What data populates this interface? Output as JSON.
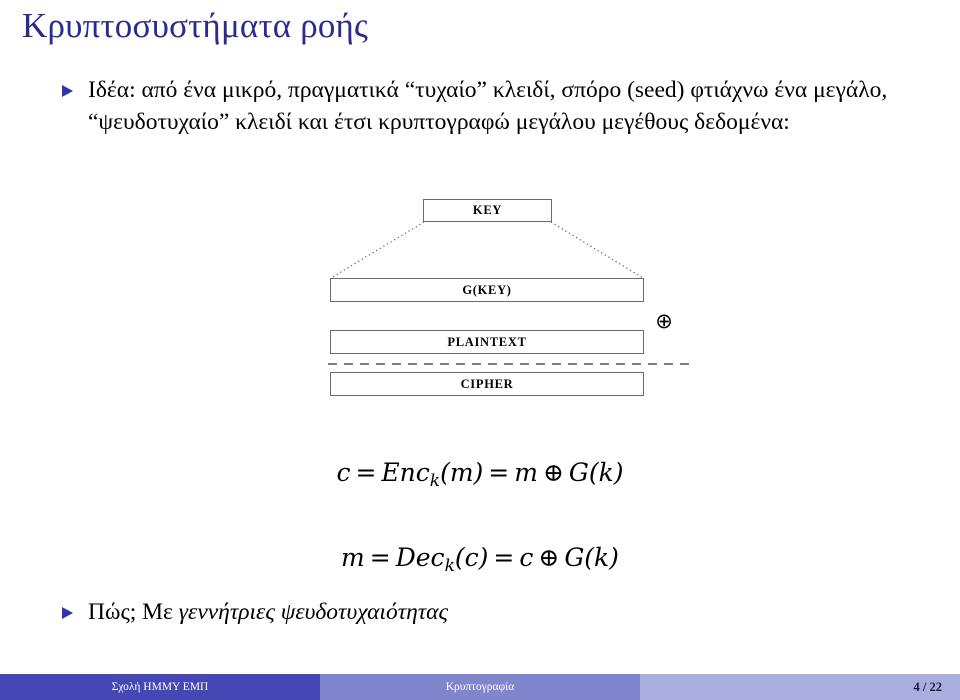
{
  "slide": {
    "title": "Κρυπτοσυστήματα ροής",
    "title_color": "#2b2b8f",
    "bullets": [
      {
        "marker": "triangle-right",
        "text_part_1": "Ιδέα: από ένα μικρό, πραγματικά “τυχαίο” κλειδί, σπόρο (seed) φτιάχνω ένα μεγάλο, “ψευδοτυχαίο” κλειδί και έτσι κρυπτογραφώ μεγάλου μεγέθους δεδομένα:",
        "text_part_2": ""
      },
      {
        "marker": "triangle-right",
        "text_part_1": "Πώς; Με ",
        "text_part_2": "γεννήτριες ψευδοτυχαιότητας"
      }
    ]
  },
  "diagram": {
    "boxes": {
      "key": "KEY",
      "gkey": "G(KEY)",
      "plaintext": "PLAINTEXT",
      "cipher": "CIPHER"
    },
    "xor_symbol": "⊕",
    "box_border_color": "#6b6b6b",
    "connector_style": "dotted",
    "separator_style": "dashed"
  },
  "formulas": {
    "encrypt": {
      "lhs": "c",
      "eq1": "=",
      "fn": "Enc",
      "fn_sub": "k",
      "fn_arg": "(m)",
      "eq2": "=",
      "rhs_var": "m",
      "rhs_op": "⊕",
      "rhs_fn": "G(k)",
      "plain": "c = Enc_k(m) = m ⊕ G(k)"
    },
    "decrypt": {
      "lhs": "m",
      "eq1": "=",
      "fn": "Dec",
      "fn_sub": "k",
      "fn_arg": "(c)",
      "eq2": "=",
      "rhs_var": "c",
      "rhs_op": "⊕",
      "rhs_fn": "G(k)",
      "plain": "m = Dec_k(c) = c ⊕ G(k)"
    }
  },
  "footer": {
    "left": "Σχολή ΗΜΜΥ ΕΜΠ",
    "center": "Κρυπτογραφία",
    "right": "4 / 22",
    "left_bg": "#4548b4",
    "center_bg": "#8086ce",
    "right_bg": "#aaaedf"
  }
}
